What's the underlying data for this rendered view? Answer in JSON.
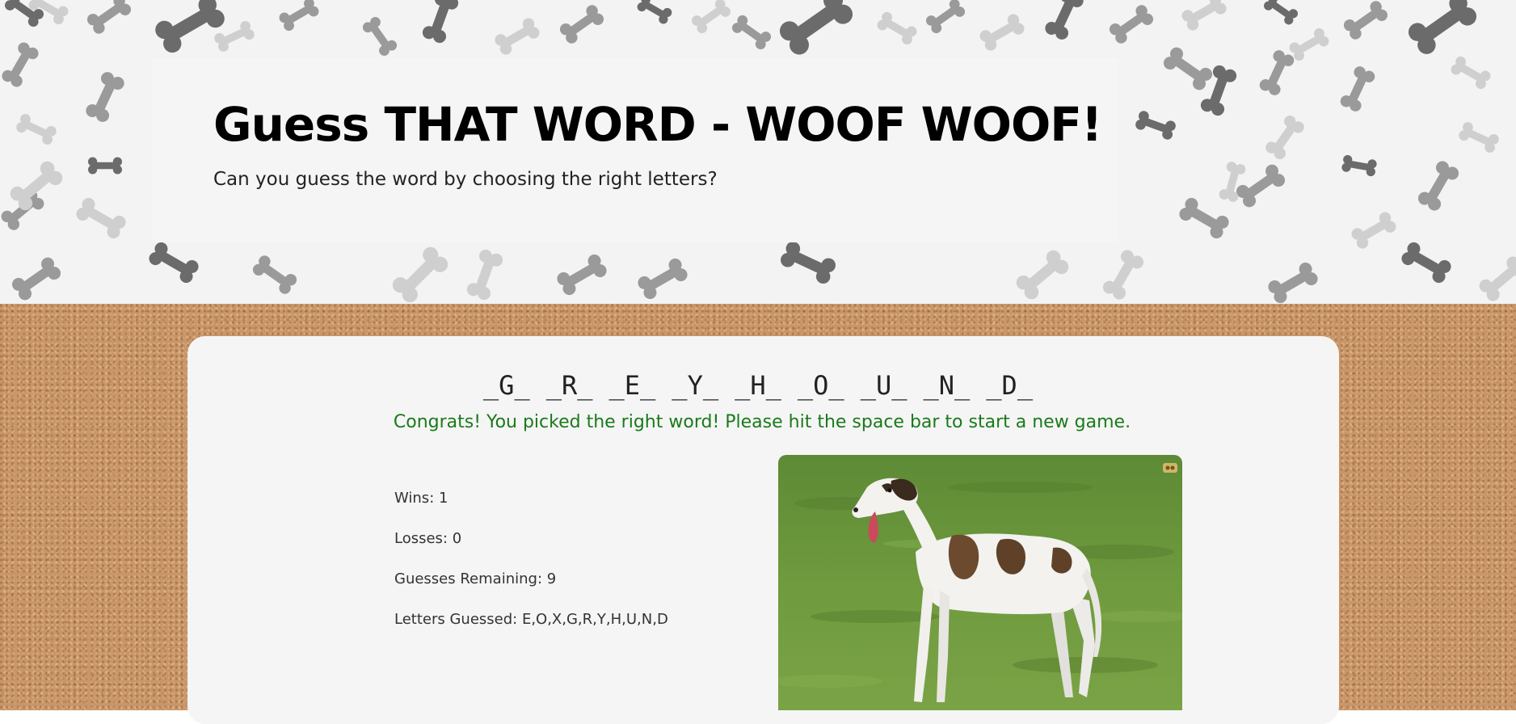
{
  "header": {
    "title": "Guess THAT WORD - WOOF WOOF!",
    "subtitle": "Can you guess the word by choosing the right letters?"
  },
  "game": {
    "word_slots": [
      "_G_",
      "_R_",
      "_E_",
      "_Y_",
      "_H_",
      "_O_",
      "_U_",
      "_N_",
      "_D_"
    ],
    "message": "Congrats! You picked the right word! Please hit the space bar to start a new game.",
    "wins": "Wins: 1",
    "losses": "Losses: 0",
    "guesses_remaining": "Guesses Remaining: 9",
    "letters_guessed": "Letters Guessed: E,O,X,G,R,Y,H,U,N,D"
  },
  "colors": {
    "message": "#1a7a1a",
    "card": "#f5f5f5",
    "cork": "#c89668",
    "bone_dark": "#6b6b6b",
    "bone_mid": "#9a9a9a",
    "bone_light": "#cfcfcf"
  },
  "images": {
    "dog_photo": "greyhound-photo",
    "background_pattern": "dog-bone-pattern",
    "background_texture": "cork-board"
  }
}
